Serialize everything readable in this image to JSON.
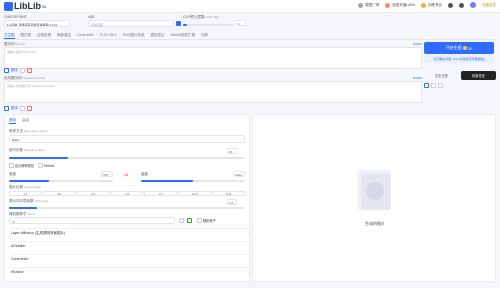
{
  "app": {
    "logo_text": "LibLib",
    "logo_sup": "AI"
  },
  "topnav": {
    "items": [
      "模型广场",
      "免费充值LoRA",
      "训练专区"
    ],
    "upgrade": "充值会员"
  },
  "model": {
    "checkpoint_label": "CHECKPOINT",
    "checkpoint_value": "F.1基础_墨秀墨写风格丹青模型 F.1-Fl...",
    "vae_label": "VAE",
    "vae_value": "自动匹配",
    "clip_label": "CLIP终止层数",
    "clip_hint": "CLIP Skip",
    "clip_value": "2"
  },
  "tabs": [
    "文生图",
    "图生图",
    "后期处理",
    "局部重绘",
    "ControlNet",
    "FLUX DEV",
    "PNG图片信息",
    "模型混合",
    "WebUI插件扩展",
    "训练"
  ],
  "prompt": {
    "label": "提示词",
    "hint": "Prompt",
    "placeholder": "请输入提示词 Prompt",
    "count": "0/2000",
    "translate_label": "翻译",
    "neg_label": "负向提示词",
    "neg_hint": "Negative Prompt",
    "neg_placeholder": "请输入负向提示词 Negative Prompt",
    "neg_count": "0/2000",
    "neg_translate_label": "翻译"
  },
  "generate": {
    "button": "开始生图",
    "cost": "20",
    "sub": "今日剩余次数: 100 (享受会员专属加速)",
    "history_tab": "历史记录",
    "batch_tab": "批量任务"
  },
  "settings": {
    "tab_basic": "基础",
    "tab_advanced": "高级",
    "sampler_label": "采样方法",
    "sampler_hint": "Sampling method",
    "sampler_value": "Euler",
    "steps_label": "迭代步数",
    "steps_hint": "Sampling steps",
    "steps_value": "20",
    "steps_fraction": 0.25,
    "hires_label": "高分辨率修复",
    "refiner_label": "Refiner",
    "width_label": "宽度",
    "width_value": "768",
    "width_fraction": 0.38,
    "height_label": "高度",
    "height_value": "1024",
    "height_fraction": 0.5,
    "ratio_label": "图片比例",
    "ratio_hint": "Aspect Ratio",
    "ratios": [
      "1:1",
      "3:2",
      "2:3",
      "4:3",
      "3:4",
      "16:9",
      "9:16"
    ],
    "cfg_label": "提示词引导系数",
    "cfg_hint": "CFG scale",
    "cfg_value": "3.5",
    "cfg_fraction": 0.12,
    "seed_label": "随机数种子",
    "seed_hint": "Seed",
    "seed_value": "-1",
    "seed_option": "随机种子"
  },
  "accordions": [
    {
      "label": "Layer-diffusion (生成透明背景图片)"
    },
    {
      "label": "ADetailer"
    },
    {
      "label": "ControlNet"
    },
    {
      "label": "ReActor"
    }
  ],
  "preview": {
    "empty_text": "生成的图片"
  },
  "colors": {
    "accent": "#2f6bff",
    "bg": "#f5f6fa"
  }
}
